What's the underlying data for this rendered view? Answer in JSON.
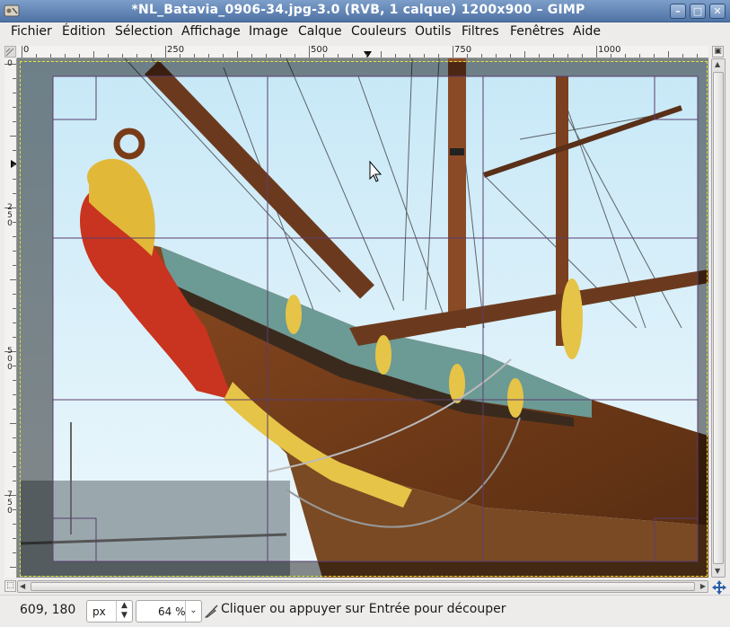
{
  "window": {
    "title": "*NL_Batavia_0906-34.jpg-3.0 (RVB, 1 calque) 1200x900 – GIMP"
  },
  "menu": [
    "Fichier",
    "Édition",
    "Sélection",
    "Affichage",
    "Image",
    "Calque",
    "Couleurs",
    "Outils",
    "Filtres",
    "Fenêtres",
    "Aide"
  ],
  "rulers": {
    "horizontal": [
      "0",
      "250",
      "500",
      "750",
      "1000"
    ],
    "vertical": [
      "0",
      "250",
      "500",
      "750"
    ]
  },
  "statusbar": {
    "coords": "609, 180",
    "unit": "px",
    "zoom": "64 %",
    "message": "Cliquer ou appuyer sur Entrée pour découper"
  },
  "icons": {
    "app": "gimp-app-icon",
    "minimize": "minimize-icon",
    "maximize": "maximize-icon",
    "close": "close-icon",
    "navigate": "navigate-icon",
    "quickmask": "quick-mask-icon",
    "zoom_fit": "zoom-fit-icon",
    "tool": "crop-tool-icon"
  },
  "colors": {
    "titlebar": "#4f73a6",
    "selection": "#e8e23a",
    "crop_guides": "#5b3d6e"
  }
}
